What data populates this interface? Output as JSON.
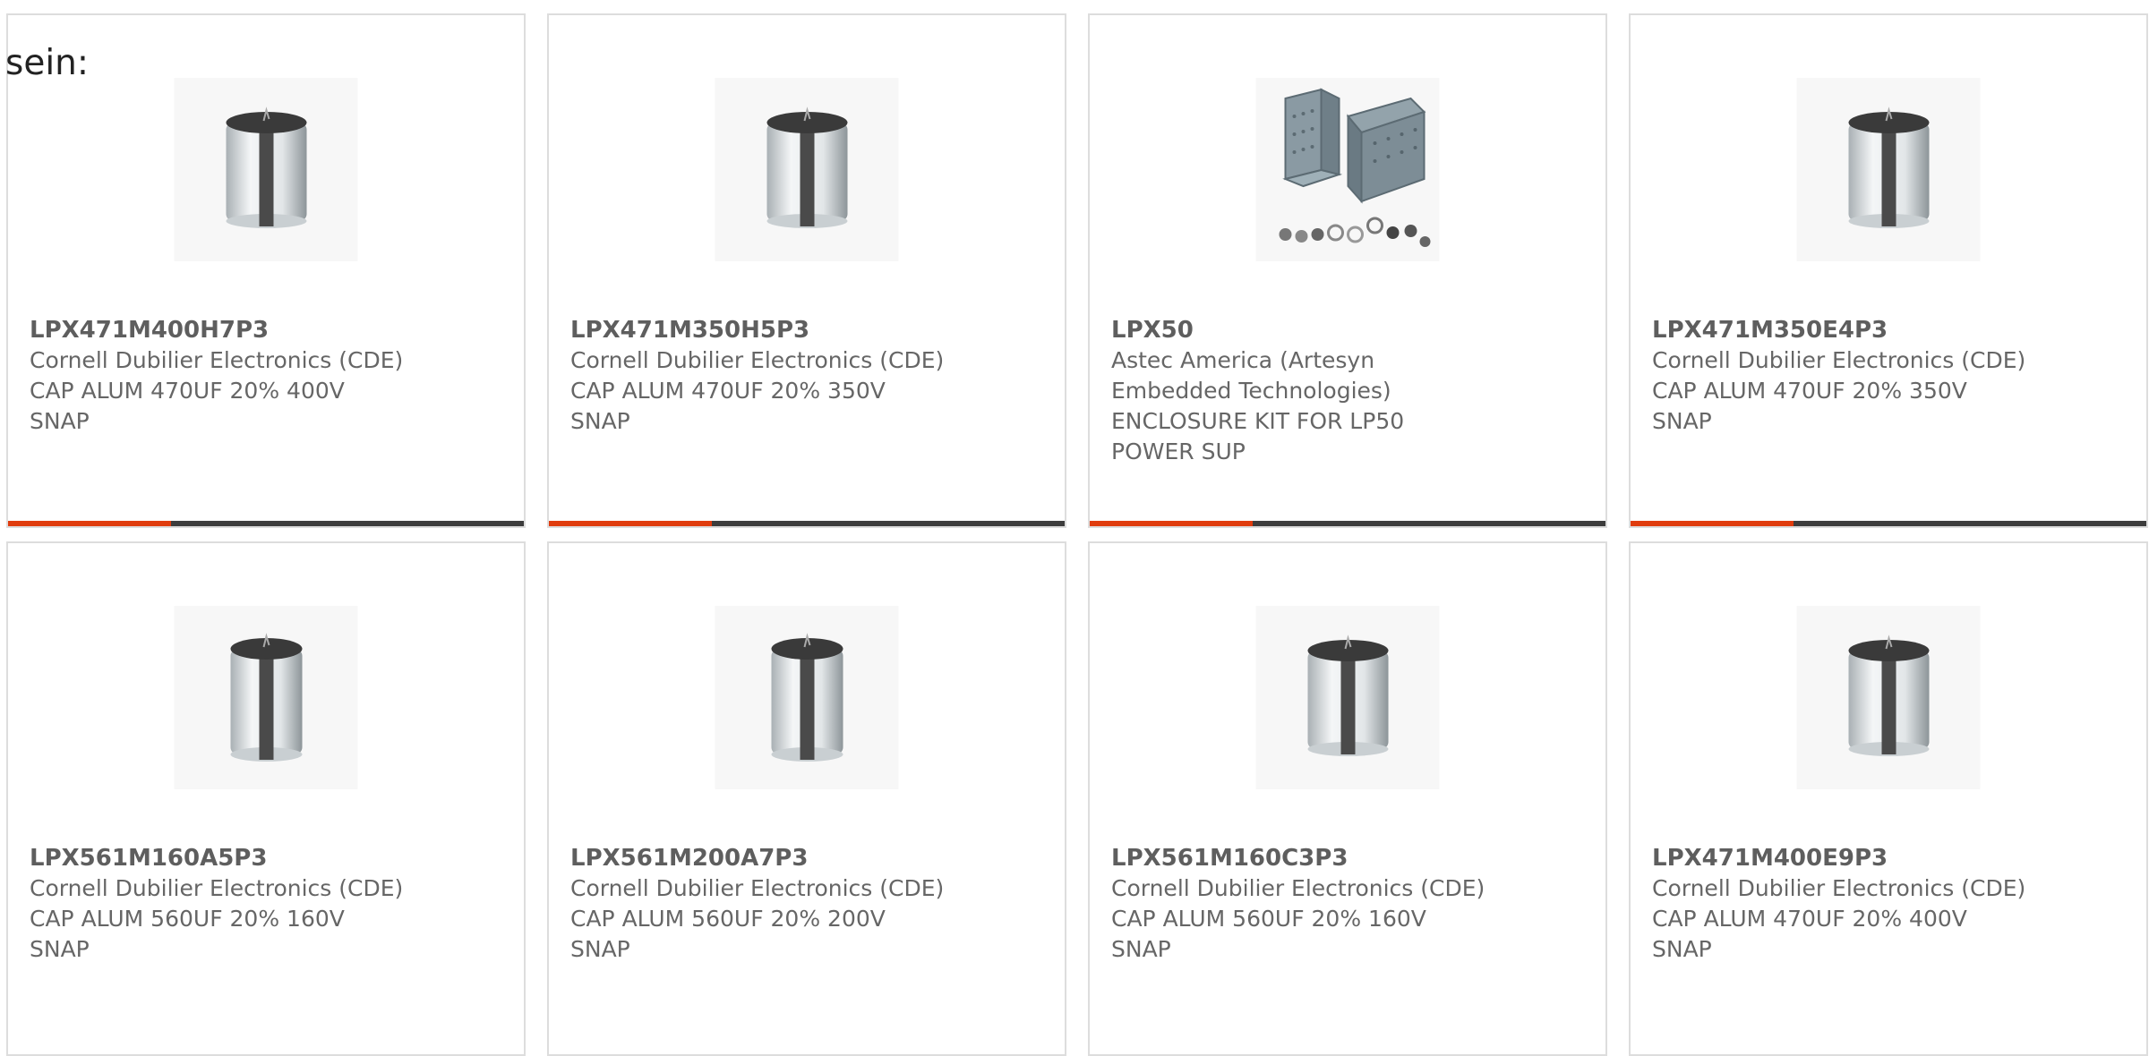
{
  "intro_text": "sein:",
  "accent_color": "#e03c0e",
  "bar_color": "#3d3d3d",
  "products": [
    {
      "part": "LPX471M400H7P3",
      "mfr": "Cornell Dubilier Electronics (CDE)",
      "desc": "CAP ALUM 470UF 20% 400V SNAP",
      "icon": "capacitor-image"
    },
    {
      "part": "LPX471M350H5P3",
      "mfr": "Cornell Dubilier Electronics (CDE)",
      "desc": "CAP ALUM 470UF 20% 350V SNAP",
      "icon": "capacitor-image"
    },
    {
      "part": "LPX50",
      "mfr": "Astec America (Artesyn Embedded Technologies)",
      "desc": "ENCLOSURE KIT FOR LP50 POWER SUP",
      "icon": "enclosure-kit-image"
    },
    {
      "part": "LPX471M350E4P3",
      "mfr": "Cornell Dubilier Electronics (CDE)",
      "desc": "CAP ALUM 470UF 20% 350V SNAP",
      "icon": "capacitor-image"
    },
    {
      "part": "LPX561M160A5P3",
      "mfr": "Cornell Dubilier Electronics (CDE)",
      "desc": "CAP ALUM 560UF 20% 160V SNAP",
      "icon": "capacitor-image"
    },
    {
      "part": "LPX561M200A7P3",
      "mfr": "Cornell Dubilier Electronics (CDE)",
      "desc": "CAP ALUM 560UF 20% 200V SNAP",
      "icon": "capacitor-image"
    },
    {
      "part": "LPX561M160C3P3",
      "mfr": "Cornell Dubilier Electronics (CDE)",
      "desc": "CAP ALUM 560UF 20% 160V SNAP",
      "icon": "capacitor-image"
    },
    {
      "part": "LPX471M400E9P3",
      "mfr": "Cornell Dubilier Electronics (CDE)",
      "desc": "CAP ALUM 470UF 20% 400V SNAP",
      "icon": "capacitor-image"
    }
  ]
}
